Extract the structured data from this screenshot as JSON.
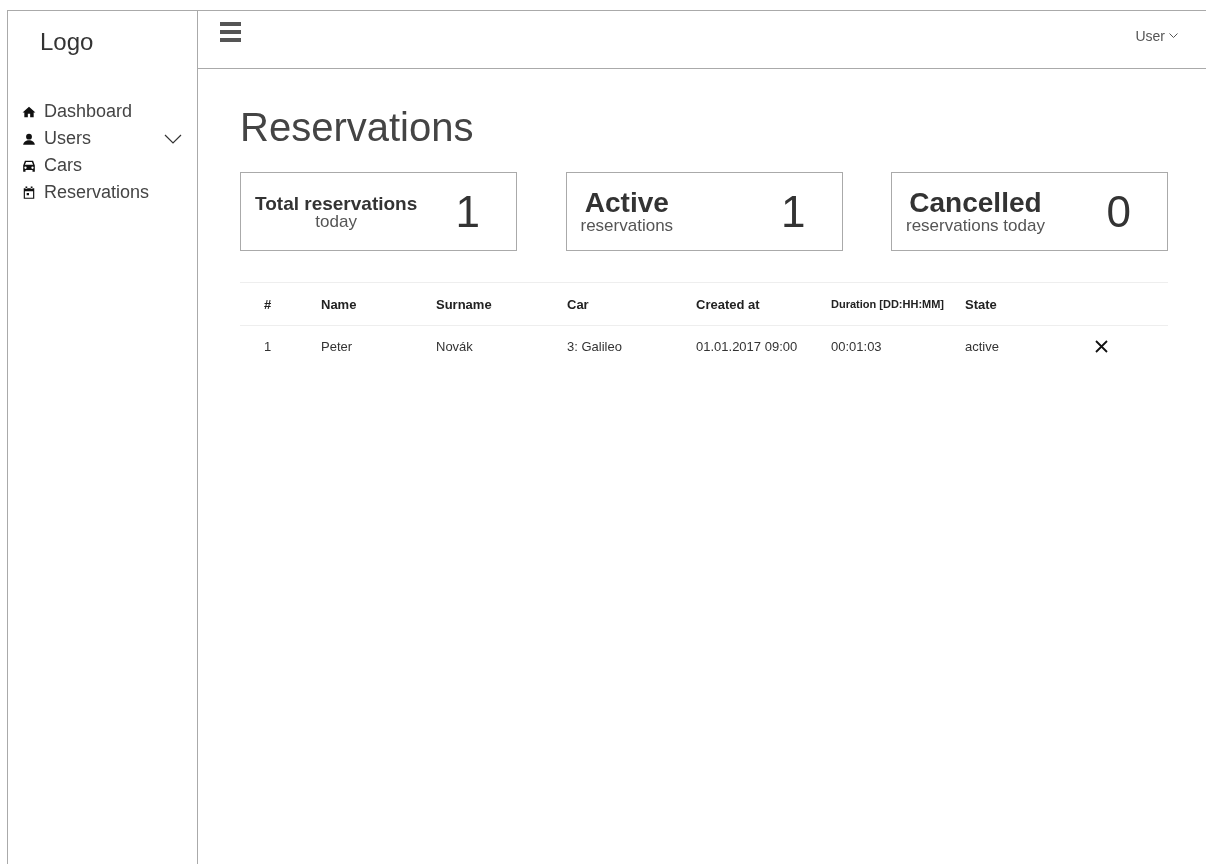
{
  "sidebar": {
    "logo": "Logo",
    "items": [
      {
        "kind": "home",
        "label": "Dashboard",
        "expandable": false
      },
      {
        "kind": "user",
        "label": "Users",
        "expandable": true
      },
      {
        "kind": "car",
        "label": "Cars",
        "expandable": false
      },
      {
        "kind": "calendar",
        "label": "Reservations",
        "expandable": false
      }
    ]
  },
  "topbar": {
    "user": "User"
  },
  "page_title": "Reservations",
  "stats": [
    {
      "title": "Total reservations",
      "subtitle": "today",
      "value": "1"
    },
    {
      "title": "Active",
      "subtitle": "reservations",
      "value": "1"
    },
    {
      "title": "Cancelled",
      "subtitle": "reservations today",
      "value": "0"
    }
  ],
  "table": {
    "columns": [
      "#",
      "Name",
      "Surname",
      "Car",
      "Created at",
      "Duration [DD:HH:MM]",
      "State"
    ],
    "rows": [
      {
        "cells": [
          "1",
          "Peter",
          "Novák",
          "3: Galileo",
          "01.01.2017 09:00",
          "00:01:03",
          "active"
        ],
        "cancellable": true
      }
    ]
  }
}
